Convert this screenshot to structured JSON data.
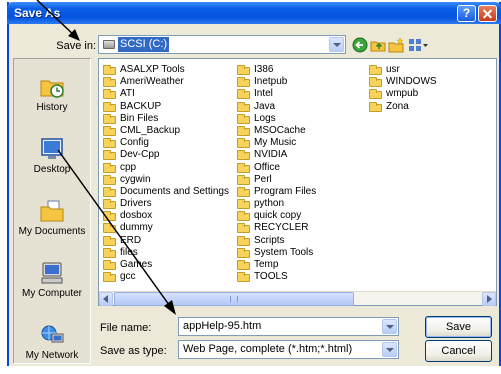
{
  "window": {
    "title": "Save As",
    "help_label": "?"
  },
  "toolbar": {
    "save_in_label": "Save in:",
    "location": "SCSI (C:)",
    "icons": [
      "back-icon",
      "up-folder-icon",
      "new-folder-icon",
      "views-icon"
    ]
  },
  "places": [
    {
      "label": "History",
      "icon": "history-icon"
    },
    {
      "label": "Desktop",
      "icon": "desktop-icon"
    },
    {
      "label": "My Documents",
      "icon": "my-documents-icon"
    },
    {
      "label": "My Computer",
      "icon": "my-computer-icon"
    },
    {
      "label": "My Network",
      "icon": "my-network-icon"
    }
  ],
  "files": {
    "columns": [
      [
        "ASALXP Tools",
        "AmeriWeather",
        "ATI",
        "BACKUP",
        "Bin Files",
        "CML_Backup",
        "Config",
        "Dev-Cpp",
        "cpp",
        "cygwin",
        "Documents and Settings",
        "Drivers",
        "dosbox",
        "dummy",
        "ERD",
        "files",
        "Games",
        "gcc"
      ],
      [
        "I386",
        "Inetpub",
        "Intel",
        "Java",
        "Logs",
        "MSOCache",
        "My Music",
        "NVIDIA",
        "Office",
        "Perl",
        "Program Files",
        "python",
        "quick copy",
        "RECYCLER",
        "Scripts",
        "System Tools",
        "Temp",
        "TOOLS"
      ],
      [
        "usr",
        "WINDOWS",
        "wmpub",
        "Zona"
      ]
    ]
  },
  "filename": {
    "label": "File name:",
    "value": "appHelp-95.htm"
  },
  "filetype": {
    "label": "Save as type:",
    "value": "Web Page, complete (*.htm;*.html)"
  },
  "buttons": {
    "save": "Save",
    "cancel": "Cancel"
  },
  "colors": {
    "dialog_bg": "#ece9d8",
    "selection": "#316ac5",
    "titlebar": "#0a5ee6"
  }
}
